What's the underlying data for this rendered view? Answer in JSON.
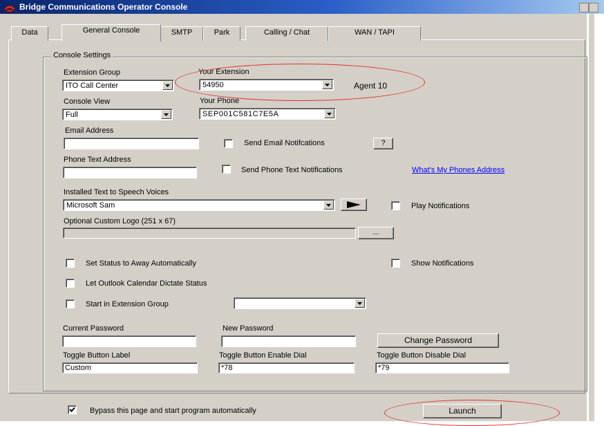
{
  "window": {
    "title": "Bridge Communications Operator Console"
  },
  "tabs": [
    "Data",
    "General Console",
    "SMTP",
    "Park",
    "Calling / Chat",
    "WAN / TAPI"
  ],
  "settings": {
    "group_label": "Console Settings",
    "extension_group": {
      "label": "Extension Group",
      "value": "ITO Call Center"
    },
    "your_extension": {
      "label": "Your Extension",
      "value": "54950",
      "agent": "Agent 10"
    },
    "console_view": {
      "label": "Console View",
      "value": "Full"
    },
    "your_phone": {
      "label": "Your Phone",
      "value": "SEP001C581C7E5A"
    },
    "email_address": {
      "label": "Email Address",
      "value": ""
    },
    "send_email": {
      "label": "Send Email Notifcations",
      "checked": false,
      "help_label": "?"
    },
    "phone_text_address": {
      "label": "Phone Text Address",
      "value": ""
    },
    "send_phone_text": {
      "label": "Send Phone Text Notifications",
      "checked": false
    },
    "whats_my_phone_link": "What's My Phones Address",
    "tts": {
      "label": "Installed Text to Speech Voices",
      "value": "Microsoft Sam"
    },
    "play_notifications": {
      "label": "Play Notifications",
      "checked": false
    },
    "custom_logo": {
      "label": "Optional Custom Logo (251 x 67)",
      "value": "",
      "browse_label": "..."
    },
    "set_away": {
      "label": "Set Status to Away Automatically",
      "checked": false
    },
    "show_notifications": {
      "label": "Show Notifications",
      "checked": false
    },
    "outlook": {
      "label": "Let Outlook Calendar Dictate Status",
      "checked": false
    },
    "start_in_group": {
      "label": "Start in Extension Group",
      "checked": false,
      "value": ""
    },
    "current_password": {
      "label": "Current Password",
      "value": ""
    },
    "new_password": {
      "label": "New Password",
      "value": ""
    },
    "change_password_label": "Change Password",
    "toggle_label": {
      "label": "Toggle Button Label",
      "value": "Custom"
    },
    "toggle_enable": {
      "label": "Toggle Button Enable Dial",
      "value": "*78"
    },
    "toggle_disable": {
      "label": "Toggle Button Disable Dial",
      "value": "*79"
    }
  },
  "bypass": {
    "label": "Bypass this page and start program automatically",
    "checked": true
  },
  "launch_label": "Launch",
  "colors": {
    "titlebar": "#0a246a",
    "face": "#d4d0c8",
    "link": "#0000ff",
    "annotation": "#e03030"
  }
}
